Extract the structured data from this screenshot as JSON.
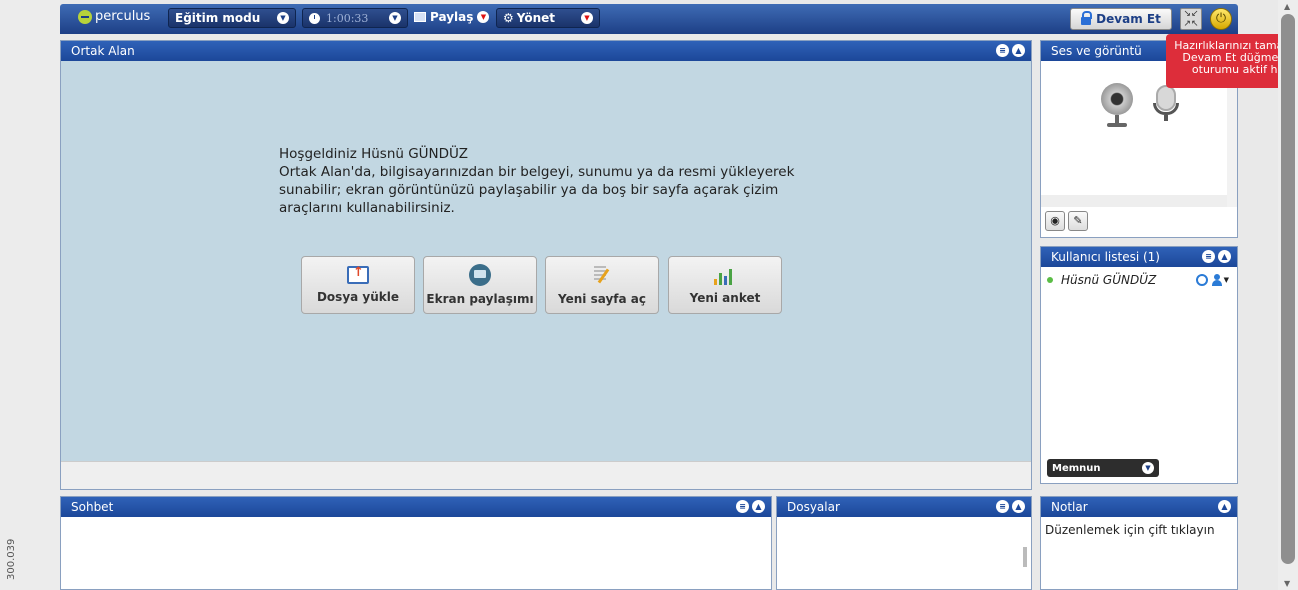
{
  "side_label": "300.039",
  "topbar": {
    "logo": "perculus",
    "mode_select": "Eğitim modu",
    "timer": "1:00:33",
    "share_label": "Paylaş",
    "manage_label": "Yönet",
    "continue_button": "Devam Et"
  },
  "tooltip": {
    "line1": "Hazırlıklarınızı tamam",
    "line2": "Devam Et düğmesin",
    "line3": "oturumu aktif hale"
  },
  "ortak": {
    "title": "Ortak Alan",
    "welcome_title": "Hoşgeldiniz Hüsnü GÜNDÜZ",
    "welcome_body": "Ortak Alan'da, bilgisayarınızdan bir belgeyi, sunumu ya da resmi yükleyerek sunabilir; ekran görüntünüzü paylaşabilir ya da boş bir sayfa açarak çizim araçlarını kullanabilirsiniz.",
    "buttons": [
      {
        "label": "Dosya yükle",
        "icon": "upload-icon"
      },
      {
        "label": "Ekran paylaşımı",
        "icon": "screen-share-icon"
      },
      {
        "label": "Yeni sayfa aç",
        "icon": "new-page-icon"
      },
      {
        "label": "Yeni anket",
        "icon": "poll-icon"
      }
    ]
  },
  "ses": {
    "title": "Ses ve görüntü"
  },
  "users": {
    "title": "Kullanıcı listesi (1)",
    "items": [
      {
        "name": "Hüsnü GÜNDÜZ",
        "status": "online"
      }
    ],
    "mood_select": "Memnun"
  },
  "sohbet": {
    "title": "Sohbet"
  },
  "dosyalar": {
    "title": "Dosyalar"
  },
  "notlar": {
    "title": "Notlar",
    "placeholder": "Düzenlemek için çift tıklayın"
  },
  "colors": {
    "header_blue": "#1c4799",
    "stage_bg": "#c2d7e2",
    "tooltip_red": "#dd2d3a",
    "online_green": "#5bbd46"
  }
}
